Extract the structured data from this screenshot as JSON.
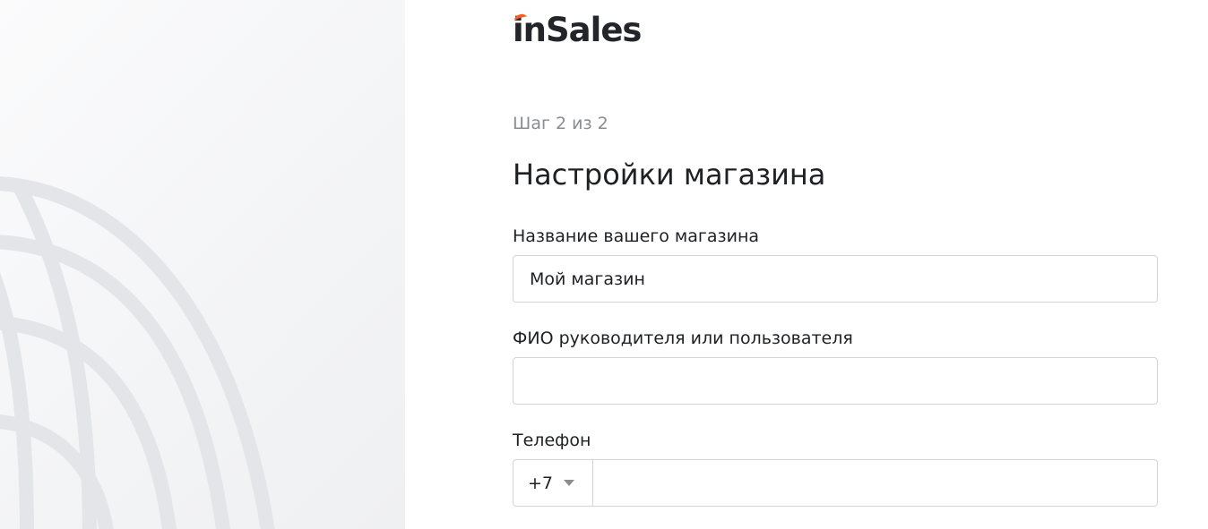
{
  "brand": {
    "logo_prefix": "in",
    "logo_suffix": "Sales",
    "accent_color": "#ff5a1f"
  },
  "form": {
    "step": "Шаг 2 из 2",
    "title": "Настройки магазина",
    "store_name": {
      "label": "Название вашего магазина",
      "value": "Мой магазин"
    },
    "owner_name": {
      "label": "ФИО руководителя или пользователя",
      "value": ""
    },
    "phone": {
      "label": "Телефон",
      "country_code": "+7",
      "value": ""
    }
  }
}
